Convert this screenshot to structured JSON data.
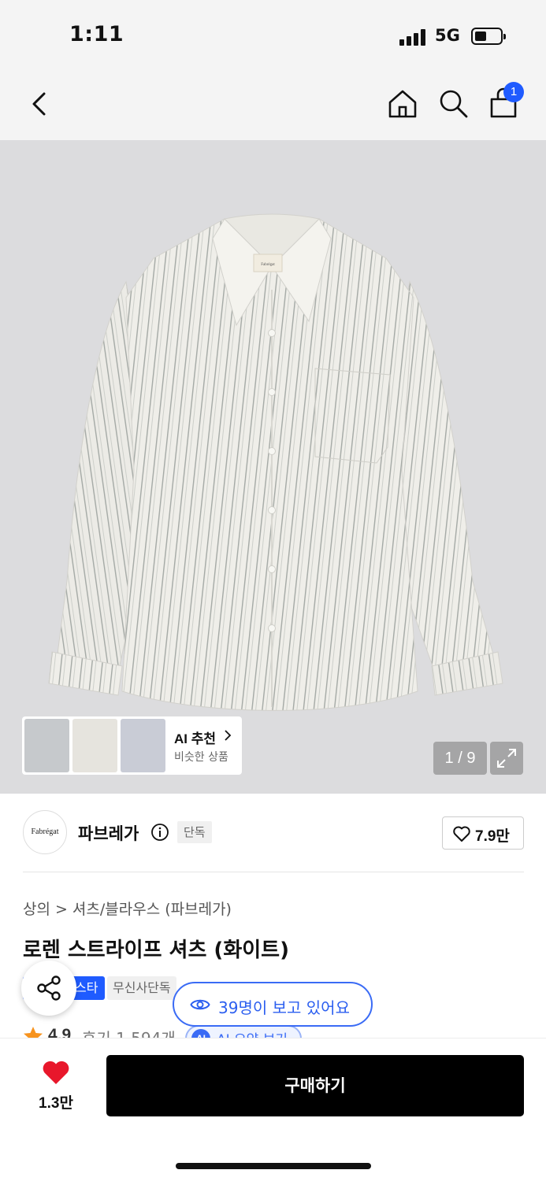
{
  "status_bar": {
    "time": "1:11",
    "network": "5G"
  },
  "nav": {
    "cart_count": "1"
  },
  "gallery": {
    "page_counter": "1 / 9",
    "brand_tag_text": "Fabrégat",
    "ai_recommend": {
      "title": "AI 추천",
      "subtitle": "비슷한 상품"
    }
  },
  "brand": {
    "logo_text": "Fabrégat",
    "name": "파브레가",
    "exclusive_badge": "단독",
    "like_count": "7.9만"
  },
  "breadcrumb": {
    "category": "상의",
    "subcategory": "셔츠/블라우스 (파브레가)"
  },
  "product": {
    "title": "로렌 스트라이프 셔츠 (화이트)",
    "tags": [
      "스타",
      "무신사단독"
    ],
    "viewers_text": "39명이 보고 있어요",
    "rating": "4.9",
    "review_text": "후기 1,594개",
    "ai_summary_badge": "AI",
    "ai_summary_label": "AI 요약 보기"
  },
  "bottom_bar": {
    "heart_count": "1.3만",
    "buy_label": "구매하기"
  },
  "colors": {
    "accent_blue": "#1f5bff",
    "heart_red": "#e8172b",
    "star_orange": "#f7931e",
    "button_black": "#000000"
  },
  "icons": [
    "back-icon",
    "home-icon",
    "search-icon",
    "cart-icon",
    "chevron-right-icon",
    "expand-icon",
    "info-icon",
    "heart-outline-icon",
    "share-icon",
    "eye-icon",
    "star-icon",
    "heart-filled-icon"
  ]
}
